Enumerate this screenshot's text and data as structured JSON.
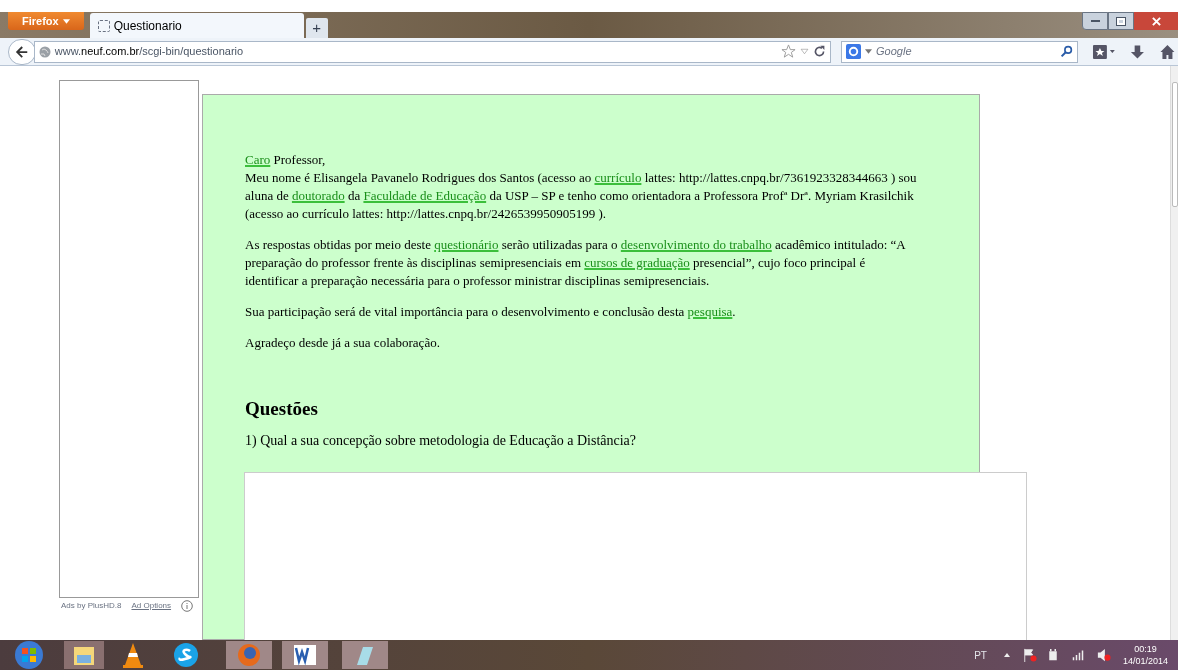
{
  "browser": {
    "menu_button": "Firefox",
    "tabs": [
      {
        "label": "Questionario",
        "selected": true
      }
    ],
    "new_tab": "+",
    "url": {
      "host_prefix": "www.",
      "host": "neuf.com.br",
      "path": "/scgi-bin/questionario"
    },
    "search": {
      "placeholder": "Google"
    }
  },
  "ad": {
    "by": "Ads by PlusHD.8",
    "options": "Ad Options"
  },
  "letter": {
    "greeting": [
      {
        "text": "Caro",
        "link": true
      },
      {
        "text": " Professor,",
        "link": false
      }
    ],
    "paragraphs": [
      [
        {
          "text": "Meu nome é Elisangela Pavanelo Rodrigues dos Santos (acesso ao ",
          "link": false
        },
        {
          "text": "currículo",
          "link": true
        },
        {
          "text": " lattes: http://lattes.cnpq.br/7361923328344663 ) sou aluna de ",
          "link": false
        },
        {
          "text": "doutorado",
          "link": true
        },
        {
          "text": " da ",
          "link": false
        },
        {
          "text": "Faculdade de Educação",
          "link": true
        },
        {
          "text": " da USP – SP e tenho como orientadora a Professora Profª Drª. Myriam Krasilchik (acesso ao currículo lattes: http://lattes.cnpq.br/2426539950905199 ).",
          "link": false
        }
      ],
      [
        {
          "text": "As respostas obtidas por meio deste ",
          "link": false
        },
        {
          "text": "questionário",
          "link": true
        },
        {
          "text": " serão utilizadas para o ",
          "link": false
        },
        {
          "text": "desenvolvimento do trabalho",
          "link": true
        },
        {
          "text": " acadêmico intitulado: “A preparação do professor frente às disciplinas semipresenciais em ",
          "link": false
        },
        {
          "text": "cursos de graduação",
          "link": true
        },
        {
          "text": " presencial”, cujo foco principal é identificar a preparação necessária para o professor ministrar disciplinas semipresenciais.",
          "link": false
        }
      ],
      [
        {
          "text": "Sua participação será de vital importância para o desenvolvimento e conclusão desta ",
          "link": false
        },
        {
          "text": "pesquisa",
          "link": true
        },
        {
          "text": ".",
          "link": false
        }
      ],
      [
        {
          "text": "Agradeço desde já a sua colaboração.",
          "link": false
        }
      ]
    ]
  },
  "questions_heading": "Questões",
  "questions": [
    {
      "text": "1) Qual a sua concepção sobre metodologia de Educação a Distância?"
    }
  ],
  "taskbar": {
    "language": "PT",
    "time": "00:19",
    "date": "14/01/2014"
  }
}
